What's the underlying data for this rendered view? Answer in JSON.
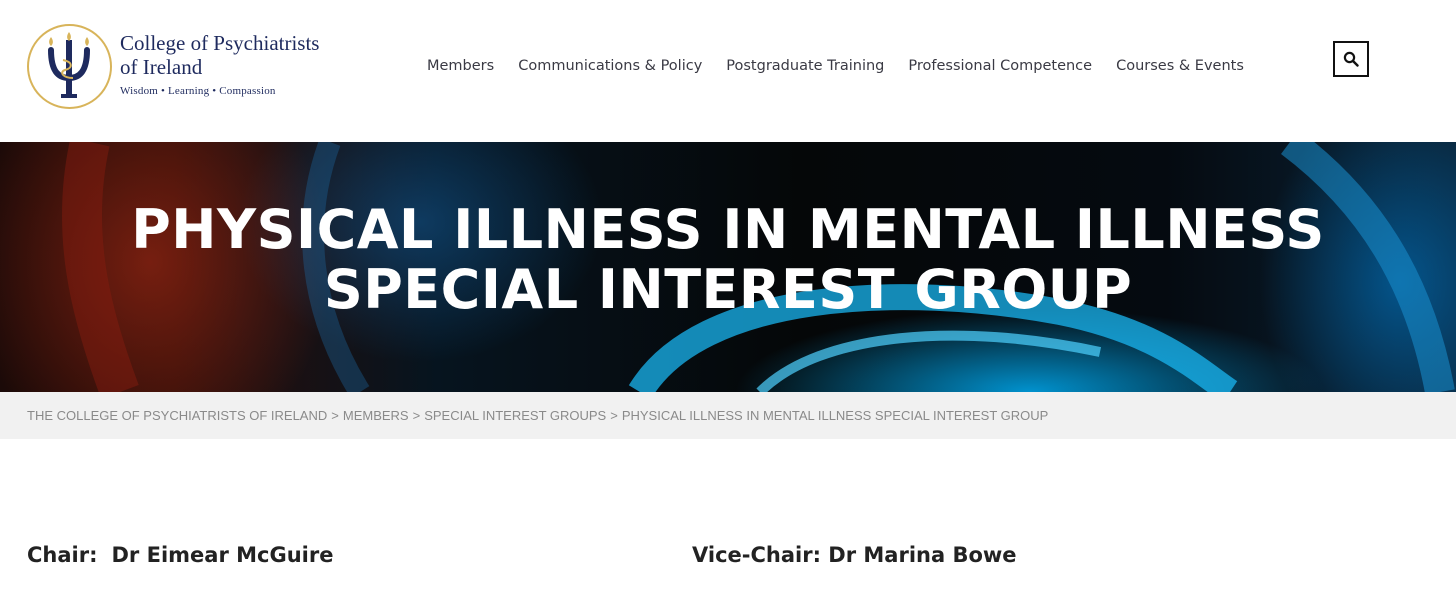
{
  "header": {
    "logo_line1": "College of Psychiatrists",
    "logo_line2": "of Ireland",
    "tagline": "Wisdom • Learning • Compassion",
    "brand_color": "#1e2a5e",
    "accent_color": "#d8b45a"
  },
  "nav": {
    "items": [
      {
        "label": "Members"
      },
      {
        "label": "Communications & Policy"
      },
      {
        "label": "Postgraduate Training"
      },
      {
        "label": "Professional Competence"
      },
      {
        "label": "Courses & Events"
      }
    ],
    "search_icon": "search-icon"
  },
  "hero": {
    "title_line1": "PHYSICAL ILLNESS IN MENTAL ILLNESS",
    "title_line2": "SPECIAL INTEREST GROUP"
  },
  "breadcrumb": {
    "items": [
      {
        "label": "THE COLLEGE OF PSYCHIATRISTS OF IRELAND"
      },
      {
        "label": "MEMBERS"
      },
      {
        "label": "SPECIAL INTEREST GROUPS"
      },
      {
        "label": "PHYSICAL ILLNESS IN MENTAL ILLNESS SPECIAL INTEREST GROUP"
      }
    ],
    "separator": ">"
  },
  "content": {
    "chair_label": "Chair:",
    "chair_name": "Dr Eimear McGuire",
    "vice_label": "Vice-Chair:",
    "vice_name": "Dr Marina Bowe"
  }
}
